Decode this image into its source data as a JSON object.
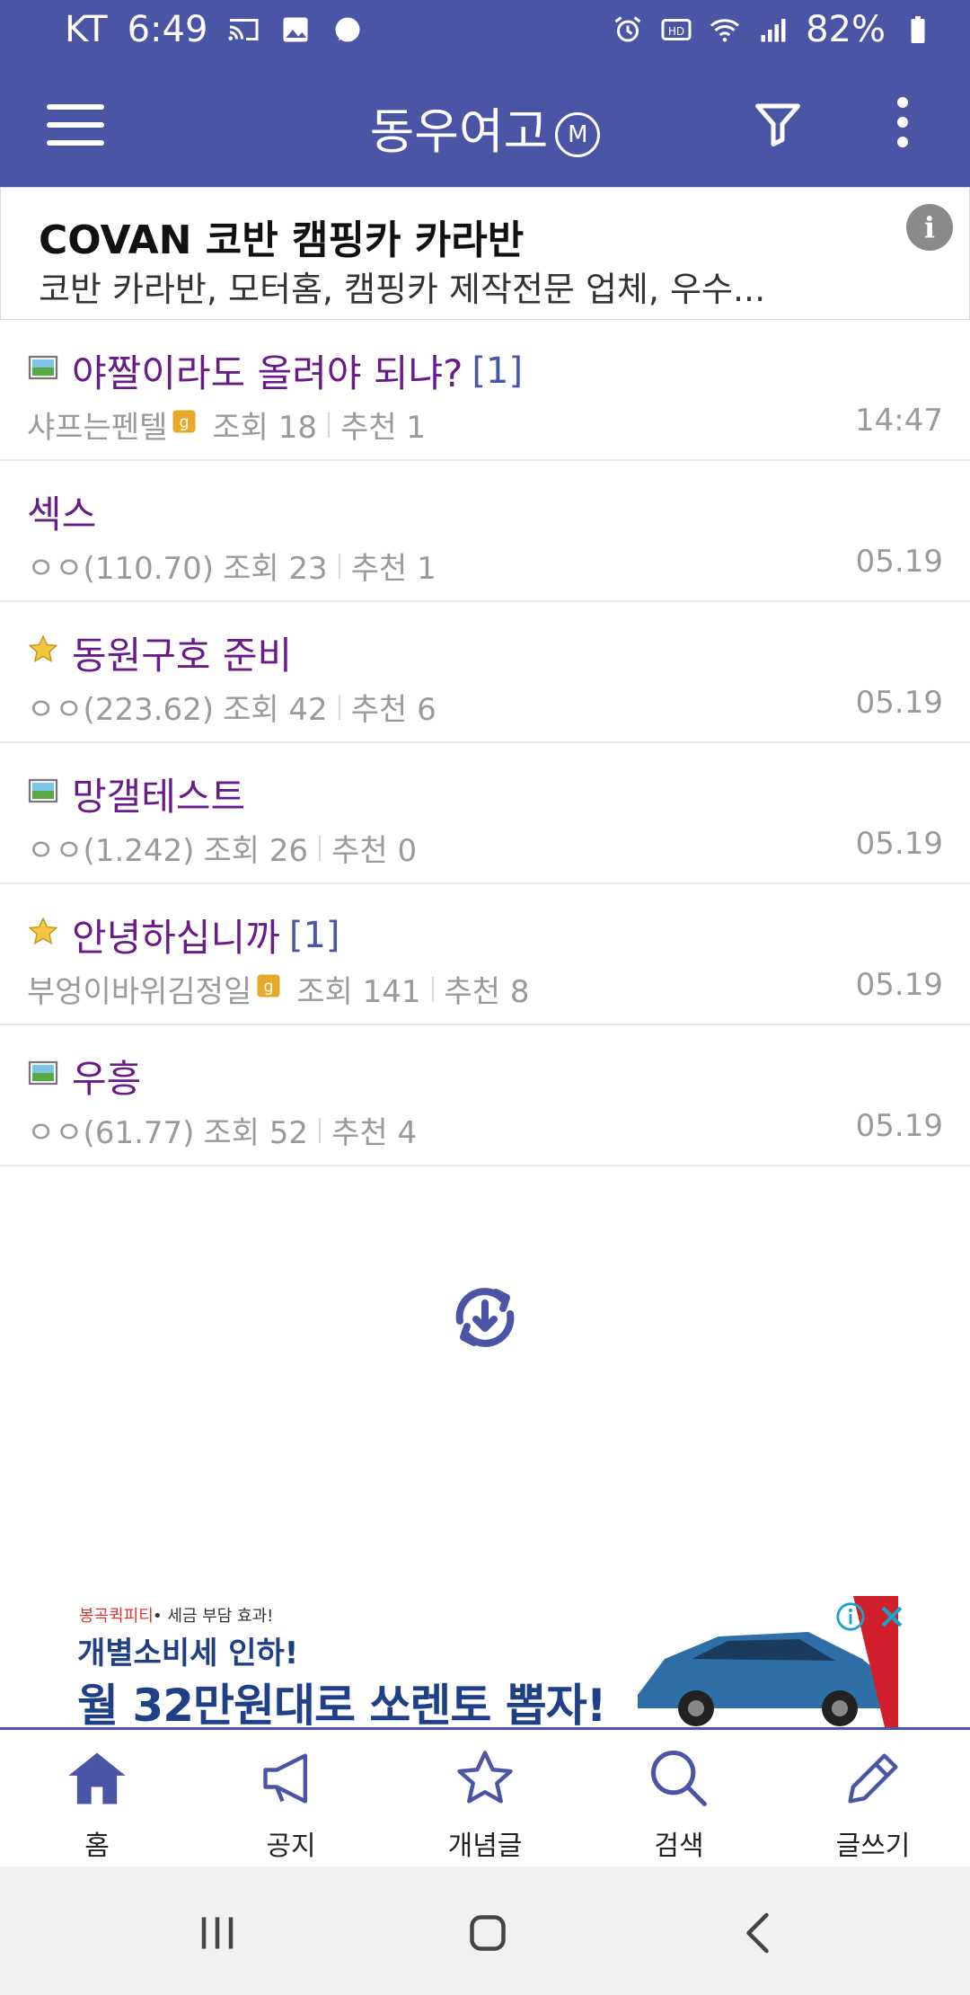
{
  "status_bar": {
    "carrier": "KT",
    "time": "6:49",
    "battery": "82%"
  },
  "app_bar": {
    "title": "동우여고",
    "badge": "M"
  },
  "top_ad": {
    "title": "COVAN 코반 캠핑카 카라반",
    "description": "코반 카라반, 모터홈, 캠핑카 제작전문 업체, 우수...",
    "info": "i"
  },
  "posts": [
    {
      "title": "야짤이라도 올려야 되냐?",
      "comments": "[1]",
      "author": "샤프는펜텔",
      "views": "조회 18",
      "recommend": "추천 1",
      "date": "14:47",
      "icon": "image-icon"
    },
    {
      "title": "섹스",
      "comments": "",
      "author": "ㅇㅇ(110.70)",
      "views": "조회 23",
      "recommend": "추천 1",
      "date": "05.19",
      "icon": ""
    },
    {
      "title": "동원구호 준비",
      "comments": "",
      "author": "ㅇㅇ(223.62)",
      "views": "조회 42",
      "recommend": "추천 6",
      "date": "05.19",
      "icon": "star-icon"
    },
    {
      "title": "망갤테스트",
      "comments": "",
      "author": "ㅇㅇ(1.242)",
      "views": "조회 26",
      "recommend": "추천 0",
      "date": "05.19",
      "icon": "image-icon"
    },
    {
      "title": "안녕하십니까",
      "comments": "[1]",
      "author": "부엉이바위김정일",
      "views": "조회 141",
      "recommend": "추천 8",
      "date": "05.19",
      "icon": "star-icon"
    },
    {
      "title": "우흥",
      "comments": "",
      "author": "ㅇㅇ(61.77)",
      "views": "조회 52",
      "recommend": "추천 4",
      "date": "05.19",
      "icon": "image-icon"
    }
  ],
  "bottom_ad": {
    "brand": "봉곡퀵피티",
    "tag": "• 세금 부담 효과!",
    "line1": "개별소비세 인하!",
    "line2": "월 32만원대로 쏘렌토 뽑자!"
  },
  "bottom_nav": [
    {
      "label": "홈",
      "icon": "home-icon"
    },
    {
      "label": "공지",
      "icon": "megaphone-icon"
    },
    {
      "label": "개념글",
      "icon": "star-outline-icon"
    },
    {
      "label": "검색",
      "icon": "search-icon"
    },
    {
      "label": "글쓰기",
      "icon": "pencil-icon"
    }
  ],
  "colors": {
    "primary": "#4b55a6",
    "title_purple": "#6a1b8a",
    "meta_gray": "#9a9a9a"
  }
}
